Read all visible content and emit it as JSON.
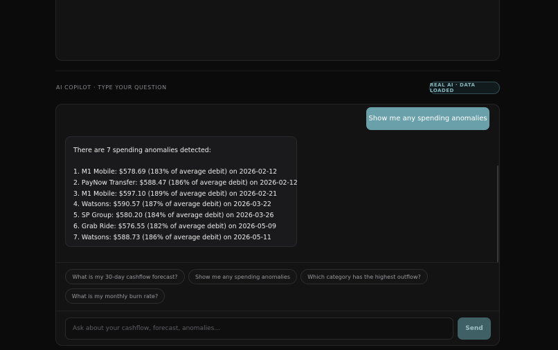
{
  "copilot": {
    "section_label": "AI COPILOT · TYPE YOUR QUESTION",
    "status_badge": "REAL AI · DATA LOADED"
  },
  "conversation": {
    "user_message": "Show me any spending anomalies",
    "ai_intro": "There are 7 spending anomalies detected:",
    "ai_items": [
      "1. M1 Mobile: $578.69 (183% of average debit) on 2026-02-12",
      "2. PayNow Transfer: $588.47 (186% of average debit) on 2026-02-12",
      "3. M1 Mobile: $597.10 (189% of average debit) on 2026-02-21",
      "4. Watsons: $590.57 (187% of average debit) on 2026-03-22",
      "5. SP Group: $580.20 (184% of average debit) on 2026-03-26",
      "6. Grab Ride: $576.55 (182% of average debit) on 2026-05-09",
      "7. Watsons: $588.73 (186% of average debit) on 2026-05-11"
    ]
  },
  "suggestions": [
    "What is my 30-day cashflow forecast?",
    "Show me any spending anomalies",
    "Which category has the highest outflow?",
    "What is my monthly burn rate?"
  ],
  "input": {
    "placeholder": "Ask about your cashflow, forecast, anomalies...",
    "value": "",
    "send_label": "Send"
  },
  "colors": {
    "accent": "#6aa0a9",
    "send_button": "#3f6166",
    "background": "#0b0b0c",
    "panel": "#131314"
  }
}
